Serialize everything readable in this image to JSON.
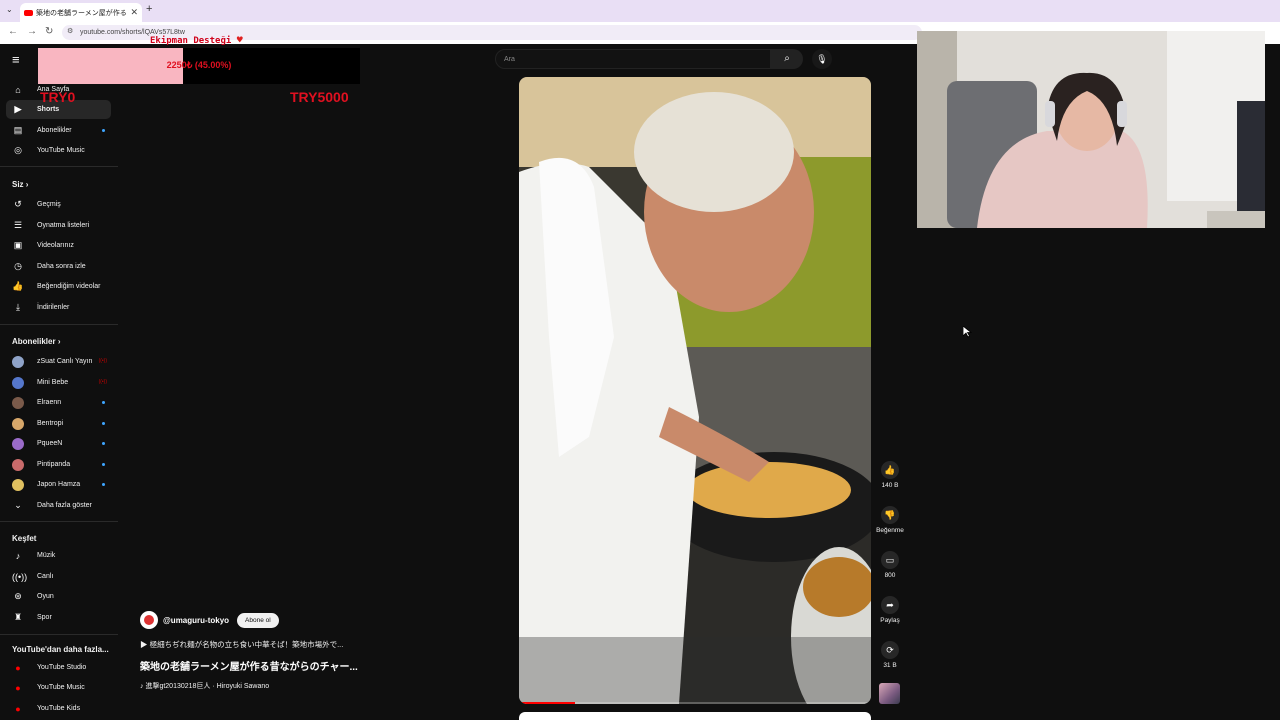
{
  "browser": {
    "tab_title": "築地の老舗ラーメン屋が作る昔ながら",
    "tab_close": "✕",
    "new_tab": "+",
    "url": "youtube.com/shorts/lQAVs57L8tw"
  },
  "overlay": {
    "donation_title": "Ekipman Desteği",
    "donation_progress_text": "2250₺ (45.00%)",
    "donation_progress_fraction": 0.45,
    "min_label": "TRY0",
    "max_label": "TRY5000"
  },
  "search": {
    "placeholder": "Ara"
  },
  "sidebar": {
    "main": [
      {
        "label": "Ana Sayfa",
        "icon": "home-icon"
      },
      {
        "label": "Shorts",
        "icon": "shorts-icon",
        "active": true
      },
      {
        "label": "Abonelikler",
        "icon": "subscriptions-icon"
      },
      {
        "label": "YouTube Music",
        "icon": "music-circle-icon"
      }
    ],
    "you_heading": "Siz",
    "you": [
      {
        "label": "Geçmiş",
        "icon": "history-icon"
      },
      {
        "label": "Oynatma listeleri",
        "icon": "playlist-icon"
      },
      {
        "label": "Videolarınız",
        "icon": "video-icon"
      },
      {
        "label": "Daha sonra izle",
        "icon": "clock-icon"
      },
      {
        "label": "Beğendiğim videolar",
        "icon": "thumbs-up-icon"
      },
      {
        "label": "İndirilenler",
        "icon": "download-icon"
      }
    ],
    "subs_heading": "Abonelikler",
    "subs": [
      {
        "label": "zSuat Canlı Yayın",
        "color": "#8fa3c8",
        "live": true
      },
      {
        "label": "Mini Bebe",
        "color": "#5577cc",
        "live": true
      },
      {
        "label": "Elraenn",
        "color": "#7a5a4a"
      },
      {
        "label": "Bentropi",
        "color": "#d7a76a"
      },
      {
        "label": "PqueeN",
        "color": "#9a6bc9"
      },
      {
        "label": "Pintipanda",
        "color": "#c96b6b"
      },
      {
        "label": "Japon Hamza",
        "color": "#e0c060"
      }
    ],
    "show_more": "Daha fazla göster",
    "explore_heading": "Keşfet",
    "explore": [
      {
        "label": "Müzik",
        "icon": "music-note-icon"
      },
      {
        "label": "Canlı",
        "icon": "live-icon"
      },
      {
        "label": "Oyun",
        "icon": "gamepad-icon"
      },
      {
        "label": "Spor",
        "icon": "trophy-icon"
      }
    ],
    "more_heading": "YouTube'dan daha fazla...",
    "more": [
      {
        "label": "YouTube Studio"
      },
      {
        "label": "YouTube Music"
      },
      {
        "label": "YouTube Kids"
      }
    ]
  },
  "short": {
    "channel": "@umaguru-tokyo",
    "subscribe": "Abone ol",
    "description": "▶ 極細ちぢれ麺が名物の立ち食い中華そば！築地市場外で...",
    "title": "築地の老舗ラーメン屋が作る昔ながらのチャー...",
    "sound": "♪ 進撃gt20130218巨人 · Hiroyuki Sawano",
    "progress_fraction": 0.16
  },
  "actions": {
    "like_count": "140 B",
    "dislike_label": "Beğenme",
    "comments_count": "800",
    "share_label": "Paylaş",
    "remix_count": "31 B"
  }
}
